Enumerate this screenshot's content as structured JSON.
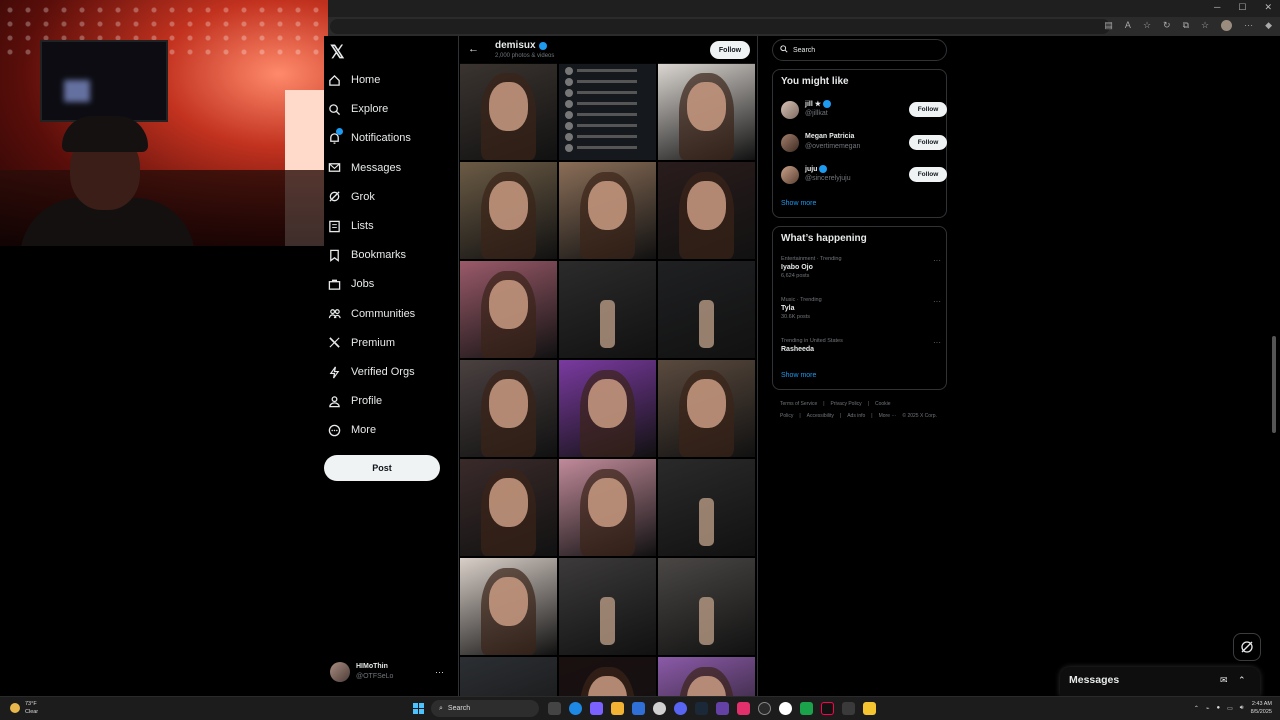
{
  "profile": {
    "name": "demisux",
    "subtitle": "2,000 photos & videos",
    "follow_label": "Follow"
  },
  "nav": {
    "items": [
      {
        "label": "Home",
        "icon": "home-icon"
      },
      {
        "label": "Explore",
        "icon": "search-icon"
      },
      {
        "label": "Notifications",
        "icon": "bell-icon"
      },
      {
        "label": "Messages",
        "icon": "envelope-icon"
      },
      {
        "label": "Grok",
        "icon": "grok-icon"
      },
      {
        "label": "Lists",
        "icon": "list-icon"
      },
      {
        "label": "Bookmarks",
        "icon": "bookmark-icon"
      },
      {
        "label": "Jobs",
        "icon": "briefcase-icon"
      },
      {
        "label": "Communities",
        "icon": "people-icon"
      },
      {
        "label": "Premium",
        "icon": "x-logo-icon"
      },
      {
        "label": "Verified Orgs",
        "icon": "lightning-icon"
      },
      {
        "label": "Profile",
        "icon": "person-icon"
      },
      {
        "label": "More",
        "icon": "more-circle-icon"
      }
    ],
    "post_label": "Post"
  },
  "account": {
    "name": "HIMoThin",
    "handle": "@OTFSeLo",
    "more": "···"
  },
  "search": {
    "placeholder": "Search"
  },
  "might_like": {
    "title": "You might like",
    "users": [
      {
        "name": "jill ★",
        "handle": "@jillkat",
        "verified": true,
        "follow": "Follow"
      },
      {
        "name": "Megan Patricia",
        "handle": "@overtimemegan",
        "verified": false,
        "follow": "Follow"
      },
      {
        "name": "juju",
        "handle": "@sincerelyjuju",
        "verified": true,
        "follow": "Follow"
      }
    ],
    "show_more": "Show more"
  },
  "happening": {
    "title": "What’s happening",
    "trends": [
      {
        "context": "Entertainment · Trending",
        "topic": "Iyabo Ojo",
        "count": "6,624 posts"
      },
      {
        "context": "Music · Trending",
        "topic": "Tyla",
        "count": "30.6K posts"
      },
      {
        "context": "Trending in United States",
        "topic": "Rasheeda",
        "count": ""
      }
    ],
    "show_more": "Show more"
  },
  "footer": {
    "links": [
      "Terms of Service",
      "|",
      "Privacy Policy",
      "|",
      "Cookie Policy",
      "|",
      "Accessibility",
      "|",
      "Ads info",
      "|",
      "More ···",
      "© 2025 X Corp."
    ]
  },
  "messages_drawer": {
    "title": "Messages"
  },
  "taskbar": {
    "weather_temp": "73°F",
    "weather_desc": "Clear",
    "search_label": "Search",
    "time": "2:43 AM",
    "date": "8/5/2025"
  },
  "colors": {
    "accent": "#1d9bf0",
    "background": "#000000",
    "text": "#e7e9ea",
    "muted": "#71767b"
  },
  "media_tiles": [
    {
      "kind": "photo",
      "tone": "#3b3430"
    },
    {
      "kind": "list",
      "tone": "#15181c"
    },
    {
      "kind": "photo",
      "tone": "#dcd7d2"
    },
    {
      "kind": "photo",
      "tone": "#6b5b45"
    },
    {
      "kind": "photo",
      "tone": "#8a6e58"
    },
    {
      "kind": "photo",
      "tone": "#2a1c1c"
    },
    {
      "kind": "photo",
      "tone": "#9a5a6a"
    },
    {
      "kind": "gym",
      "tone": "#2b2b2b"
    },
    {
      "kind": "gym",
      "tone": "#1f2022"
    },
    {
      "kind": "photo",
      "tone": "#4a4040"
    },
    {
      "kind": "photo",
      "tone": "#7a3aa0"
    },
    {
      "kind": "photo",
      "tone": "#5a4a3e"
    },
    {
      "kind": "photo",
      "tone": "#3a2a2a"
    },
    {
      "kind": "photo",
      "tone": "#c08a9a"
    },
    {
      "kind": "gym",
      "tone": "#2a2a2a"
    },
    {
      "kind": "photo",
      "tone": "#d9cfc8"
    },
    {
      "kind": "gym",
      "tone": "#3c3a3a"
    },
    {
      "kind": "gym",
      "tone": "#4a4745"
    },
    {
      "kind": "gym",
      "tone": "#2c2f33"
    },
    {
      "kind": "photo",
      "tone": "#1a1010"
    },
    {
      "kind": "photo",
      "tone": "#8b5aa8"
    }
  ]
}
